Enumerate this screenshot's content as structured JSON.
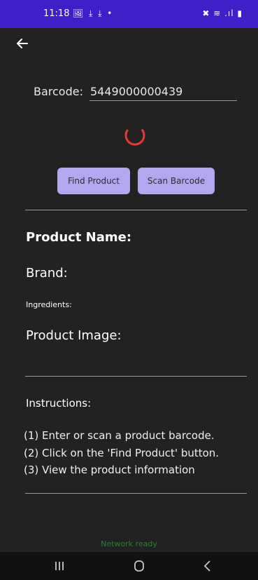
{
  "status_bar": {
    "time": "11:18",
    "left_icons": "🖼 ⤓ ⤓ •",
    "right_icons": "✖ ≋ .ıl ▮"
  },
  "icons": {
    "back": "arrow-left-icon",
    "spinner": "loading-spinner-icon",
    "nav_recents": "recents-icon",
    "nav_home": "home-icon",
    "nav_back": "back-icon"
  },
  "form": {
    "barcode_label": "Barcode:",
    "barcode_value": "5449000000439"
  },
  "buttons": {
    "find_product": "Find Product",
    "scan_barcode": "Scan Barcode"
  },
  "product": {
    "name_label": "Product Name:",
    "brand_label": "Brand:",
    "ingredients_label": "Ingredients:",
    "image_label": "Product Image:"
  },
  "instructions": {
    "title": "Instructions:",
    "steps": [
      " (1) Enter or scan a product barcode.",
      "(2) Click on the 'Find Product' button.",
      "(3) View the product information"
    ]
  },
  "footer": {
    "network_status": "Network ready"
  },
  "colors": {
    "status_bar": "#3f1fc8",
    "background": "#222222",
    "button": "#b4a7ef",
    "spinner": "#e53935",
    "network_status": "#2e7d32"
  }
}
